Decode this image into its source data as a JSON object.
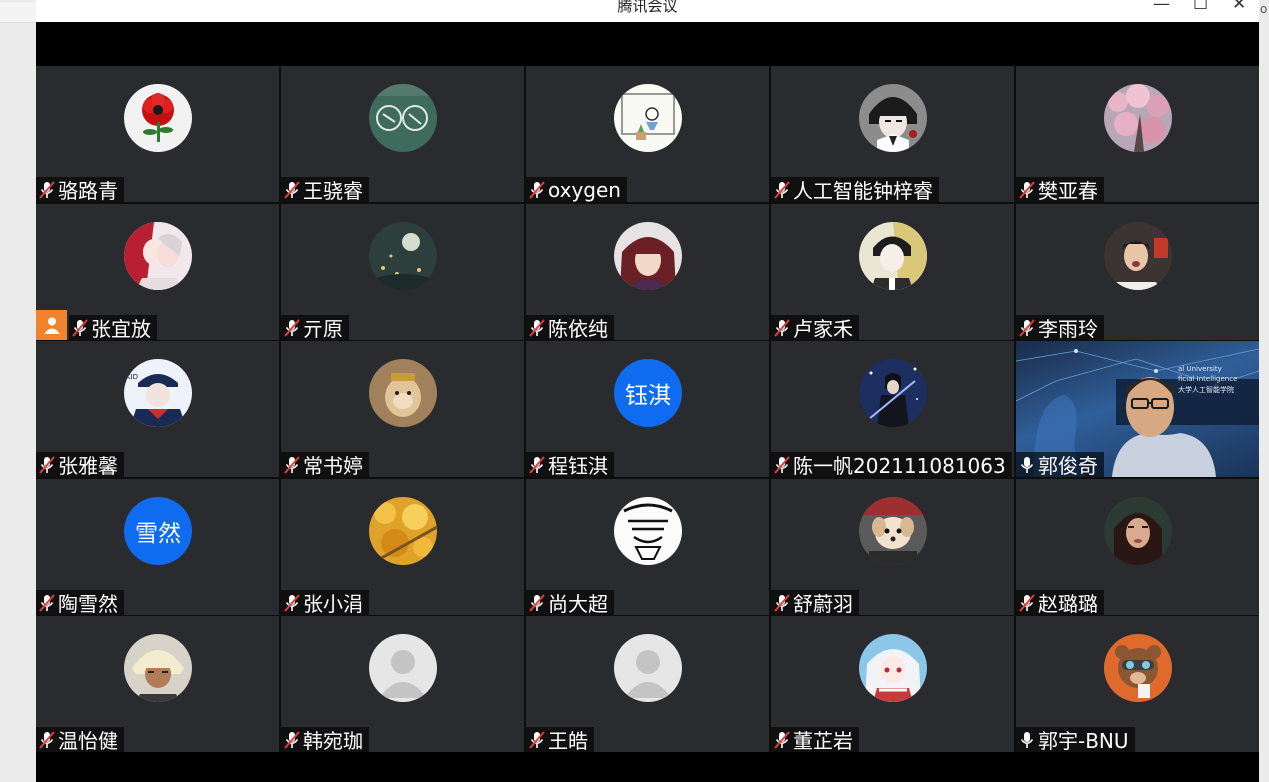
{
  "window": {
    "title": "腾讯会议",
    "minimize_glyph": "—",
    "maximize_glyph": "☐",
    "close_glyph": "✕",
    "edge_fragment": "o"
  },
  "colors": {
    "tile_bg": "#2a2b2e",
    "host_badge": "#f0832b",
    "initials_avatar": "#0f6cf0",
    "active_speaker_border": "#24a36b"
  },
  "participants": [
    {
      "name": "骆路青",
      "mic": "muted",
      "avatar": "red-flower-photo"
    },
    {
      "name": "王骁睿",
      "mic": "muted",
      "avatar": "chalkboard-photo"
    },
    {
      "name": "oxygen",
      "mic": "muted",
      "avatar": "doodle-desk-photo"
    },
    {
      "name": "人工智能钟梓睿",
      "mic": "muted",
      "avatar": "anime-character-photo"
    },
    {
      "name": "樊亚春",
      "mic": "muted",
      "avatar": "cherry-blossom-photo"
    },
    {
      "name": "张宜放",
      "mic": "muted",
      "avatar": "anime-couple-photo",
      "host": true
    },
    {
      "name": "亓原",
      "mic": "muted",
      "avatar": "night-moon-photo"
    },
    {
      "name": "陈依纯",
      "mic": "muted",
      "avatar": "anime-portrait-photo"
    },
    {
      "name": "卢家禾",
      "mic": "muted",
      "avatar": "anime-boy-photo"
    },
    {
      "name": "李雨玲",
      "mic": "muted",
      "avatar": "girl-photo"
    },
    {
      "name": "张雅馨",
      "mic": "muted",
      "avatar": "kid-character-photo"
    },
    {
      "name": "常书婷",
      "mic": "muted",
      "avatar": "monkey-king-photo"
    },
    {
      "name": "程钰淇",
      "mic": "muted",
      "initials": "钰淇"
    },
    {
      "name": "陈一帆202111081063",
      "mic": "muted",
      "avatar": "swordsman-photo"
    },
    {
      "name": "郭俊奇",
      "mic": "on",
      "video": true,
      "video_lines": [
        "al University",
        "ficial Intelligence",
        "大学人工智能学院"
      ]
    },
    {
      "name": "陶雪然",
      "mic": "muted",
      "initials": "雪然"
    },
    {
      "name": "张小涓",
      "mic": "muted",
      "avatar": "ginkgo-leaves-photo"
    },
    {
      "name": "尚大超",
      "mic": "muted",
      "avatar": "ink-drawing-photo"
    },
    {
      "name": "舒蔚羽",
      "mic": "muted",
      "avatar": "puppy-photo"
    },
    {
      "name": "赵璐璐",
      "mic": "muted",
      "avatar": "woman-portrait-photo"
    },
    {
      "name": "温怡健",
      "mic": "muted",
      "avatar": "anime-blonde-photo"
    },
    {
      "name": "韩宛珈",
      "mic": "muted",
      "avatar": "default-user-avatar"
    },
    {
      "name": "王皓",
      "mic": "muted",
      "avatar": "default-user-avatar"
    },
    {
      "name": "董芷岩",
      "mic": "muted",
      "avatar": "anime-white-hair-photo"
    },
    {
      "name": "郭宇-BNU",
      "mic": "on",
      "avatar": "cartoon-bear-photo"
    }
  ]
}
